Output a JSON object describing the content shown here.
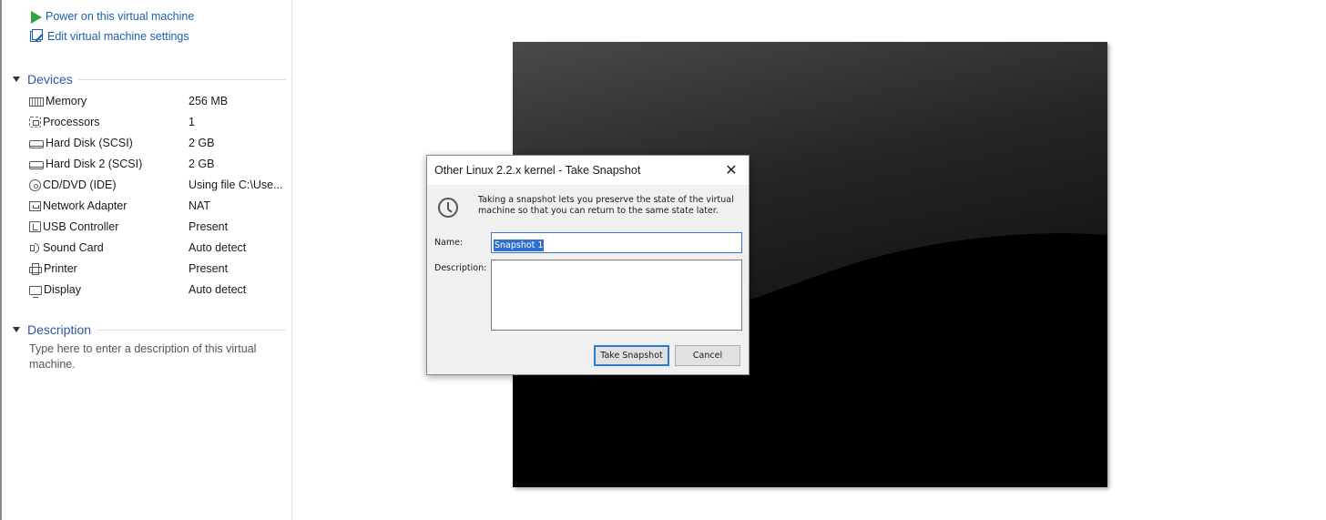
{
  "commands": {
    "power_on": "Power on this virtual machine",
    "edit_settings": "Edit virtual machine settings"
  },
  "devices": {
    "title": "Devices",
    "items": [
      {
        "name": "Memory",
        "value": "256 MB",
        "icon": "memory-icon"
      },
      {
        "name": "Processors",
        "value": "1",
        "icon": "processor-icon"
      },
      {
        "name": "Hard Disk (SCSI)",
        "value": "2 GB",
        "icon": "hard-disk-icon"
      },
      {
        "name": "Hard Disk 2 (SCSI)",
        "value": "2 GB",
        "icon": "hard-disk-icon"
      },
      {
        "name": "CD/DVD (IDE)",
        "value": "Using file C:\\Use...",
        "icon": "cd-dvd-icon"
      },
      {
        "name": "Network Adapter",
        "value": "NAT",
        "icon": "network-adapter-icon"
      },
      {
        "name": "USB Controller",
        "value": "Present",
        "icon": "usb-controller-icon"
      },
      {
        "name": "Sound Card",
        "value": "Auto detect",
        "icon": "sound-card-icon"
      },
      {
        "name": "Printer",
        "value": "Present",
        "icon": "printer-icon"
      },
      {
        "name": "Display",
        "value": "Auto detect",
        "icon": "display-icon"
      }
    ]
  },
  "description": {
    "title": "Description",
    "placeholder": "Type here to enter a description of this virtual machine."
  },
  "dialog": {
    "title": "Other Linux 2.2.x kernel - Take Snapshot",
    "close": "✕",
    "info": "Taking a snapshot lets you preserve the state of the virtual machine so that you can return to the same state later.",
    "name_label": "Name:",
    "name_value": "Snapshot 1",
    "description_label": "Description:",
    "description_value": "",
    "take_snapshot_button": "Take Snapshot",
    "cancel_button": "Cancel"
  },
  "colors": {
    "link": "#1c5fb0",
    "section_heading": "#2b58a8",
    "power_green": "#2fa63d",
    "selection_blue": "#2f6fd0"
  }
}
